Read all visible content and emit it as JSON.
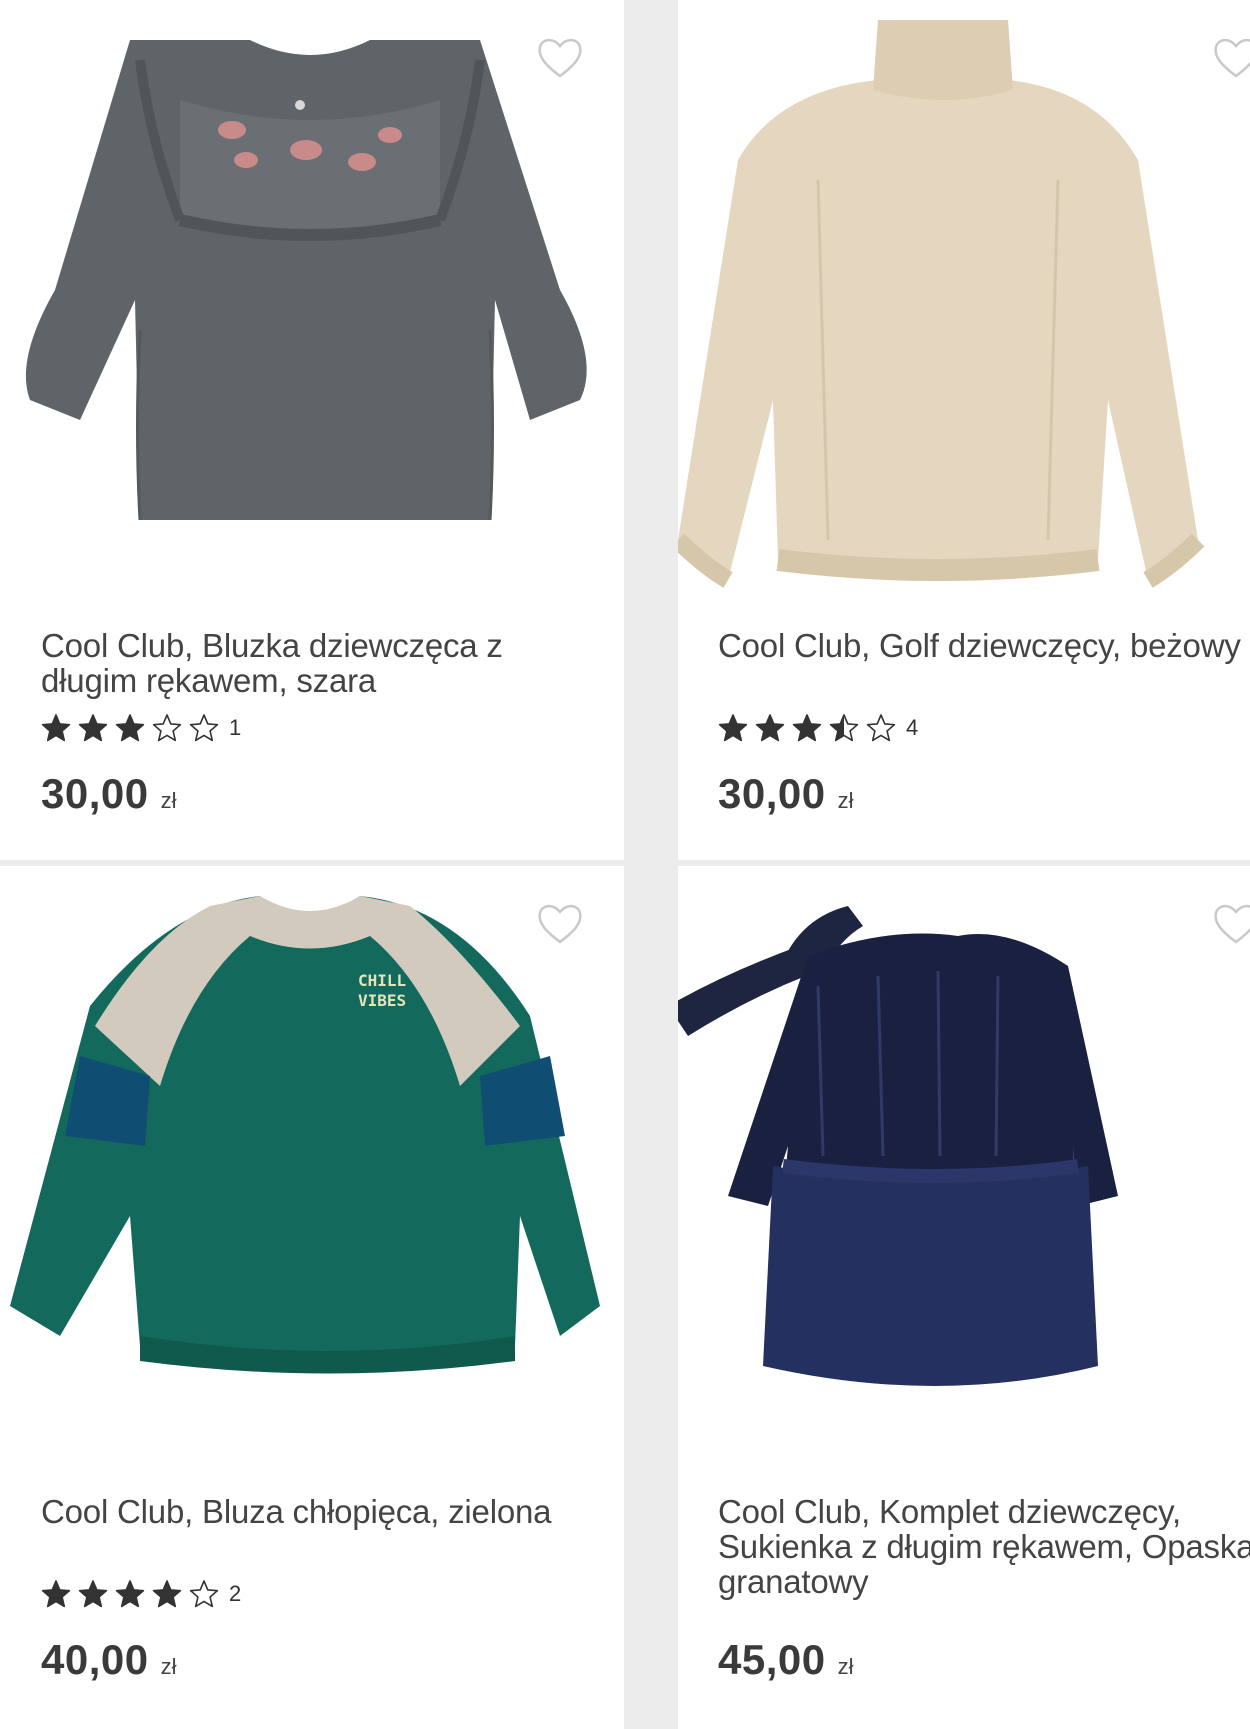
{
  "products": [
    {
      "title": "Cool Club, Bluzka dziewczęca z długim rękawem, szara",
      "rating": 3,
      "rating_count": "1",
      "price": "30,00",
      "currency": "zł",
      "image": "grey-ruffle-blouse",
      "wishlist_icon": "heart-outline-icon"
    },
    {
      "title": "Cool Club, Golf dziewczęcy, beżowy",
      "rating": 3.5,
      "rating_count": "4",
      "price": "30,00",
      "currency": "zł",
      "image": "beige-turtleneck",
      "wishlist_icon": "heart-outline-icon"
    },
    {
      "title": "Cool Club, Bluza chłopięca, zielona",
      "rating": 4,
      "rating_count": "2",
      "price": "40,00",
      "currency": "zł",
      "image": "green-sweatshirt",
      "image_text": [
        "CHILL",
        "VIBES"
      ],
      "wishlist_icon": "heart-outline-icon"
    },
    {
      "title": "Cool Club, Komplet dziewczęcy, Sukienka z długim rękawem, Opaska, granatowy",
      "rating": 0,
      "rating_count": "",
      "price": "45,00",
      "currency": "zł",
      "image": "navy-velvet-dress-with-headband",
      "wishlist_icon": "heart-outline-icon"
    }
  ],
  "colors": {
    "star_filled": "#333333",
    "star_empty": "#333333",
    "card_bg": "#ffffff",
    "page_bg": "#ececec"
  }
}
